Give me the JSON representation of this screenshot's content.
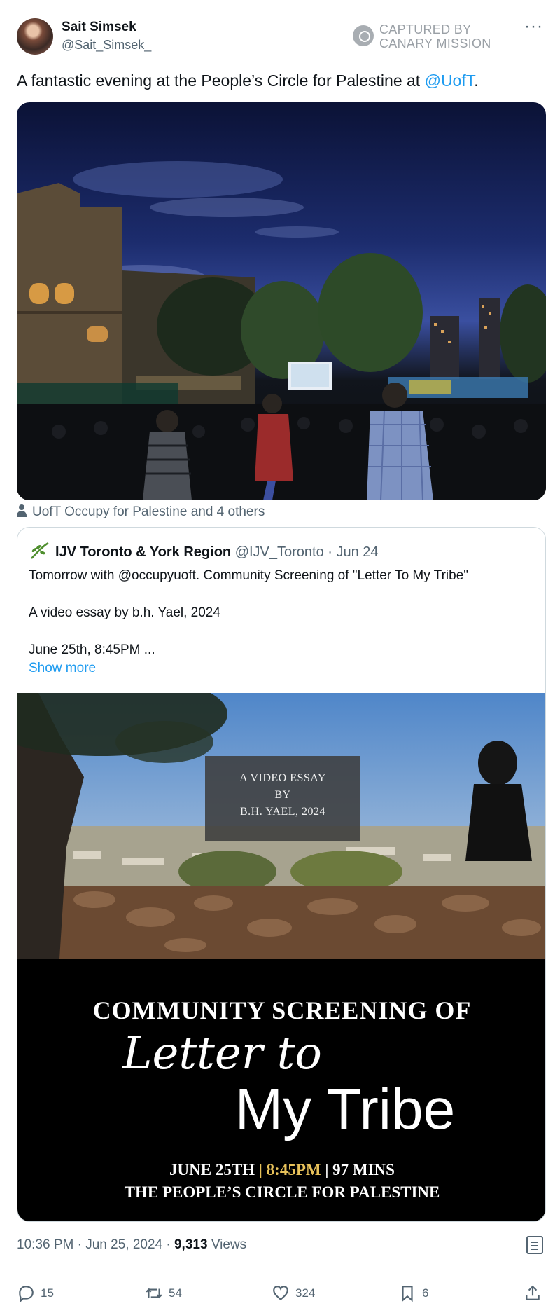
{
  "author": {
    "name": "Sait Simsek",
    "handle": "@Sait_Simsek_"
  },
  "captured_badge": {
    "line1": "CAPTURED BY",
    "line2": "CANARY MISSION"
  },
  "more_label": "···",
  "tweet": {
    "text_before": "A fantastic evening at the People’s Circle for Palestine at ",
    "mention": "@UofT",
    "text_after": "."
  },
  "tagged": "UofT Occupy for Palestine and 4 others",
  "quote": {
    "name": "IJV Toronto & York Region",
    "handle": "@IJV_Toronto",
    "date": "Jun 24",
    "line1": "Tomorrow with @occupyuoft. Community Screening of \"Letter To My Tribe\"",
    "line2": "A video essay by b.h. Yael, 2024",
    "line3": "June 25th, 8:45PM ...",
    "show_more": "Show more",
    "poster": {
      "essay_line1": "A VIDEO ESSAY",
      "essay_line2": "BY",
      "essay_line3": "B.H. YAEL, 2024",
      "heading": "COMMUNITY SCREENING OF",
      "script_title": "Letter to",
      "title": "My Tribe",
      "date": "JUNE 25TH",
      "time": "8:45PM",
      "duration": "97 MINS",
      "venue": "THE PEOPLE’S CIRCLE FOR PALESTINE"
    }
  },
  "meta": {
    "time": "10:36 PM",
    "date": "Jun 25, 2024",
    "views": "9,313",
    "views_label": "Views"
  },
  "actions": {
    "replies": "15",
    "reposts": "54",
    "likes": "324",
    "bookmarks": "6"
  },
  "colors": {
    "link": "#1d9bf0",
    "muted": "#536471",
    "time_highlight": "#e8c25a"
  }
}
